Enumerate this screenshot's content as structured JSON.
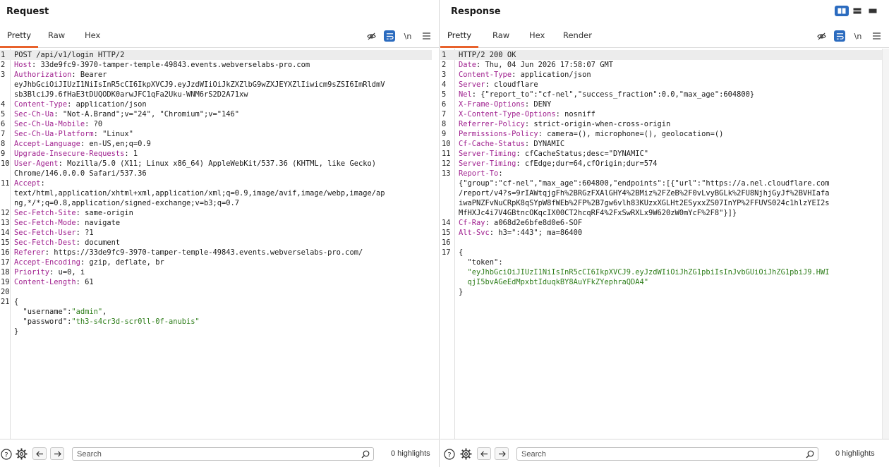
{
  "request": {
    "title": "Request",
    "tabs": [
      {
        "label": "Pretty",
        "active": true
      },
      {
        "label": "Raw"
      },
      {
        "label": "Hex"
      }
    ],
    "wrap_label": "\\n",
    "lines": [
      {
        "n": "1",
        "parts": [
          {
            "t": "plain",
            "v": "POST /api/v1/login HTTP/2"
          }
        ]
      },
      {
        "n": "2",
        "parts": [
          {
            "t": "hk",
            "v": "Host"
          },
          {
            "t": "hv",
            "v": ": 33de9fc9-3970-tamper-temple-49843.events.webverselabs-pro.com"
          }
        ]
      },
      {
        "n": "3",
        "parts": [
          {
            "t": "hk",
            "v": "Authorization"
          },
          {
            "t": "hv",
            "v": ": Bearer"
          }
        ]
      },
      {
        "n": "",
        "parts": [
          {
            "t": "hv",
            "v": "eyJhbGciOiJIUzI1NiIsInR5cCI6IkpXVCJ9.eyJzdWIiOiJkZXZlbG9wZXJEYXZlIiwicm9sZSI6ImRldmV"
          }
        ]
      },
      {
        "n": "",
        "parts": [
          {
            "t": "hv",
            "v": "sb3BlciJ9.6fHaE3tDUQODK0arwJFC1qFa2Uku-WNM6rS2D2A71xw"
          }
        ]
      },
      {
        "n": "4",
        "parts": [
          {
            "t": "hk",
            "v": "Content-Type"
          },
          {
            "t": "hv",
            "v": ": application/json"
          }
        ]
      },
      {
        "n": "5",
        "parts": [
          {
            "t": "hk",
            "v": "Sec-Ch-Ua"
          },
          {
            "t": "hv",
            "v": ": \"Not-A.Brand\";v=\"24\", \"Chromium\";v=\"146\""
          }
        ]
      },
      {
        "n": "6",
        "parts": [
          {
            "t": "hk",
            "v": "Sec-Ch-Ua-Mobile"
          },
          {
            "t": "hv",
            "v": ": ?0"
          }
        ]
      },
      {
        "n": "7",
        "parts": [
          {
            "t": "hk",
            "v": "Sec-Ch-Ua-Platform"
          },
          {
            "t": "hv",
            "v": ": \"Linux\""
          }
        ]
      },
      {
        "n": "8",
        "parts": [
          {
            "t": "hk",
            "v": "Accept-Language"
          },
          {
            "t": "hv",
            "v": ": en-US,en;q=0.9"
          }
        ]
      },
      {
        "n": "9",
        "parts": [
          {
            "t": "hk",
            "v": "Upgrade-Insecure-Requests"
          },
          {
            "t": "hv",
            "v": ": 1"
          }
        ]
      },
      {
        "n": "10",
        "parts": [
          {
            "t": "hk",
            "v": "User-Agent"
          },
          {
            "t": "hv",
            "v": ": Mozilla/5.0 (X11; Linux x86_64) AppleWebKit/537.36 (KHTML, like Gecko)"
          }
        ]
      },
      {
        "n": "",
        "parts": [
          {
            "t": "hv",
            "v": "Chrome/146.0.0.0 Safari/537.36"
          }
        ]
      },
      {
        "n": "11",
        "parts": [
          {
            "t": "hk",
            "v": "Accept"
          },
          {
            "t": "hv",
            "v": ":"
          }
        ]
      },
      {
        "n": "",
        "parts": [
          {
            "t": "hv",
            "v": "text/html,application/xhtml+xml,application/xml;q=0.9,image/avif,image/webp,image/ap"
          }
        ]
      },
      {
        "n": "",
        "parts": [
          {
            "t": "hv",
            "v": "ng,*/*;q=0.8,application/signed-exchange;v=b3;q=0.7"
          }
        ]
      },
      {
        "n": "12",
        "parts": [
          {
            "t": "hk",
            "v": "Sec-Fetch-Site"
          },
          {
            "t": "hv",
            "v": ": same-origin"
          }
        ]
      },
      {
        "n": "13",
        "parts": [
          {
            "t": "hk",
            "v": "Sec-Fetch-Mode"
          },
          {
            "t": "hv",
            "v": ": navigate"
          }
        ]
      },
      {
        "n": "14",
        "parts": [
          {
            "t": "hk",
            "v": "Sec-Fetch-User"
          },
          {
            "t": "hv",
            "v": ": ?1"
          }
        ]
      },
      {
        "n": "15",
        "parts": [
          {
            "t": "hk",
            "v": "Sec-Fetch-Dest"
          },
          {
            "t": "hv",
            "v": ": document"
          }
        ]
      },
      {
        "n": "16",
        "parts": [
          {
            "t": "hk",
            "v": "Referer"
          },
          {
            "t": "hv",
            "v": ": https://33de9fc9-3970-tamper-temple-49843.events.webverselabs-pro.com/"
          }
        ]
      },
      {
        "n": "17",
        "parts": [
          {
            "t": "hk",
            "v": "Accept-Encoding"
          },
          {
            "t": "hv",
            "v": ": gzip, deflate, br"
          }
        ]
      },
      {
        "n": "18",
        "parts": [
          {
            "t": "hk",
            "v": "Priority"
          },
          {
            "t": "hv",
            "v": ": u=0, i"
          }
        ]
      },
      {
        "n": "19",
        "parts": [
          {
            "t": "hk",
            "v": "Content-Length"
          },
          {
            "t": "hv",
            "v": ": 61"
          }
        ]
      },
      {
        "n": "20",
        "parts": []
      },
      {
        "n": "21",
        "parts": [
          {
            "t": "jp",
            "v": "{"
          }
        ]
      },
      {
        "n": "",
        "parts": [
          {
            "t": "jp",
            "v": "  "
          },
          {
            "t": "jk",
            "v": "\"username\""
          },
          {
            "t": "jp",
            "v": ":"
          },
          {
            "t": "js",
            "v": "\"admin\""
          },
          {
            "t": "jp",
            "v": ","
          }
        ]
      },
      {
        "n": "",
        "parts": [
          {
            "t": "jp",
            "v": "  "
          },
          {
            "t": "jk",
            "v": "\"password\""
          },
          {
            "t": "jp",
            "v": ":"
          },
          {
            "t": "js",
            "v": "\"th3-s4cr3d-scr0ll-0f-anubis\""
          }
        ]
      },
      {
        "n": "",
        "parts": [
          {
            "t": "jp",
            "v": "}"
          }
        ]
      }
    ],
    "search": {
      "placeholder": "Search",
      "value": ""
    },
    "highlights": "0 highlights"
  },
  "response": {
    "title": "Response",
    "tabs": [
      {
        "label": "Pretty",
        "active": true
      },
      {
        "label": "Raw"
      },
      {
        "label": "Hex"
      },
      {
        "label": "Render"
      }
    ],
    "wrap_label": "\\n",
    "lines": [
      {
        "n": "1",
        "parts": [
          {
            "t": "plain",
            "v": "HTTP/2 200 OK"
          }
        ]
      },
      {
        "n": "2",
        "parts": [
          {
            "t": "hk",
            "v": "Date"
          },
          {
            "t": "hv",
            "v": ": Thu, 04 Jun 2026 17:58:07 GMT"
          }
        ]
      },
      {
        "n": "3",
        "parts": [
          {
            "t": "hk",
            "v": "Content-Type"
          },
          {
            "t": "hv",
            "v": ": application/json"
          }
        ]
      },
      {
        "n": "4",
        "parts": [
          {
            "t": "hk",
            "v": "Server"
          },
          {
            "t": "hv",
            "v": ": cloudflare"
          }
        ]
      },
      {
        "n": "5",
        "parts": [
          {
            "t": "hk",
            "v": "Nel"
          },
          {
            "t": "hv",
            "v": ": {\"report_to\":\"cf-nel\",\"success_fraction\":0.0,\"max_age\":604800}"
          }
        ]
      },
      {
        "n": "6",
        "parts": [
          {
            "t": "hk",
            "v": "X-Frame-Options"
          },
          {
            "t": "hv",
            "v": ": DENY"
          }
        ]
      },
      {
        "n": "7",
        "parts": [
          {
            "t": "hk",
            "v": "X-Content-Type-Options"
          },
          {
            "t": "hv",
            "v": ": nosniff"
          }
        ]
      },
      {
        "n": "8",
        "parts": [
          {
            "t": "hk",
            "v": "Referrer-Policy"
          },
          {
            "t": "hv",
            "v": ": strict-origin-when-cross-origin"
          }
        ]
      },
      {
        "n": "9",
        "parts": [
          {
            "t": "hk",
            "v": "Permissions-Policy"
          },
          {
            "t": "hv",
            "v": ": camera=(), microphone=(), geolocation=()"
          }
        ]
      },
      {
        "n": "10",
        "parts": [
          {
            "t": "hk",
            "v": "Cf-Cache-Status"
          },
          {
            "t": "hv",
            "v": ": DYNAMIC"
          }
        ]
      },
      {
        "n": "11",
        "parts": [
          {
            "t": "hk",
            "v": "Server-Timing"
          },
          {
            "t": "hv",
            "v": ": cfCacheStatus;desc=\"DYNAMIC\""
          }
        ]
      },
      {
        "n": "12",
        "parts": [
          {
            "t": "hk",
            "v": "Server-Timing"
          },
          {
            "t": "hv",
            "v": ": cfEdge;dur=64,cfOrigin;dur=574"
          }
        ]
      },
      {
        "n": "13",
        "parts": [
          {
            "t": "hk",
            "v": "Report-To"
          },
          {
            "t": "hv",
            "v": ":"
          }
        ]
      },
      {
        "n": "",
        "parts": [
          {
            "t": "hv",
            "v": "{\"group\":\"cf-nel\",\"max_age\":604800,\"endpoints\":[{\"url\":\"https://a.nel.cloudflare.com"
          }
        ]
      },
      {
        "n": "",
        "parts": [
          {
            "t": "hv",
            "v": "/report/v4?s=9rIAWtqjgFh%2BRGzFXAlGHY4%2BMiz%2FZeB%2F0vLvyBGLk%2FU8NjhjGyJf%2BVHIafa"
          }
        ]
      },
      {
        "n": "",
        "parts": [
          {
            "t": "hv",
            "v": "iwaPNZFvNuCRpK8qSYpW8fWEb%2FP%2B7gw6vlh83KUzxXGLHt2ESyxxZS07InYP%2FFUVS024c1hlzYEI2s"
          }
        ]
      },
      {
        "n": "",
        "parts": [
          {
            "t": "hv",
            "v": "MfHXJc4i7V4GBtncOKqcIX00CT2hcqRF4%2FxSwRXLx9W620zW0mYcF%2F8\"}]}"
          }
        ]
      },
      {
        "n": "14",
        "parts": [
          {
            "t": "hk",
            "v": "Cf-Ray"
          },
          {
            "t": "hv",
            "v": ": a068d2e6bfe8d0e6-SOF"
          }
        ]
      },
      {
        "n": "15",
        "parts": [
          {
            "t": "hk",
            "v": "Alt-Svc"
          },
          {
            "t": "hv",
            "v": ": h3=\":443\"; ma=86400"
          }
        ]
      },
      {
        "n": "16",
        "parts": []
      },
      {
        "n": "17",
        "parts": [
          {
            "t": "jp",
            "v": "{"
          }
        ]
      },
      {
        "n": "",
        "parts": [
          {
            "t": "jp",
            "v": "  "
          },
          {
            "t": "jk",
            "v": "\"token\""
          },
          {
            "t": "jp",
            "v": ":"
          }
        ]
      },
      {
        "n": "",
        "parts": [
          {
            "t": "js",
            "v": "  \"eyJhbGciOiJIUzI1NiIsInR5cCI6IkpXVCJ9.eyJzdWIiOiJhZG1pbiIsInJvbGUiOiJhZG1pbiJ9.HWI"
          }
        ]
      },
      {
        "n": "",
        "parts": [
          {
            "t": "js",
            "v": "  qjI5bvAGeEdMpxbtIduqkBY8AuYFkZYephraQDA4\""
          }
        ]
      },
      {
        "n": "",
        "parts": [
          {
            "t": "jp",
            "v": "}"
          }
        ]
      }
    ],
    "search": {
      "placeholder": "Search",
      "value": ""
    },
    "highlights": "0 highlights"
  },
  "colors": {
    "accent_tab": "#e8622c",
    "toggle_blue": "#2b6bbf",
    "header_key": "#a0218f",
    "json_string": "#2e7d1a"
  },
  "icons": {
    "layout": [
      "side-by-side-icon",
      "top-bottom-icon",
      "single-pane-icon"
    ],
    "tools": [
      "hide-eye-icon",
      "word-wrap-icon",
      "newline-icon",
      "menu-icon"
    ],
    "bottom": [
      "help-icon",
      "settings-gear-icon",
      "back-arrow-icon",
      "forward-arrow-icon",
      "search-icon"
    ]
  }
}
